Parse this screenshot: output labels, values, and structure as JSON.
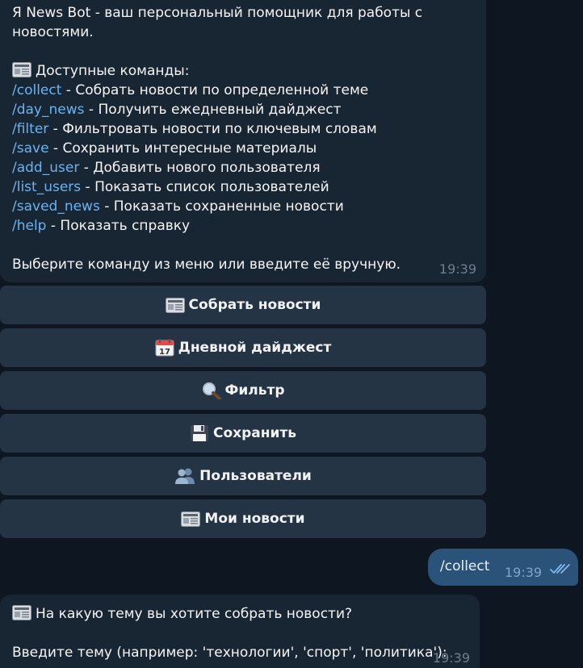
{
  "bot_message": {
    "intro_line1": "Я News Bot - ваш персональный помощник для работы с",
    "intro_line2": "новостями.",
    "commands_header": "Доступные команды:",
    "commands": [
      {
        "cmd": "/collect",
        "desc": " - Собрать новости по определенной теме"
      },
      {
        "cmd": "/day_news",
        "desc": " - Получить ежедневный дайджест"
      },
      {
        "cmd": "/filter",
        "desc": " - Фильтровать новости по ключевым словам"
      },
      {
        "cmd": "/save",
        "desc": " - Сохранить интересные материалы"
      },
      {
        "cmd": "/add_user",
        "desc": " - Добавить нового пользователя"
      },
      {
        "cmd": "/list_users",
        "desc": " - Показать список пользователей"
      },
      {
        "cmd": "/saved_news",
        "desc": " - Показать сохраненные новости"
      },
      {
        "cmd": "/help",
        "desc": " - Показать справку"
      }
    ],
    "footer": "Выберите команду из меню или введите её вручную.",
    "time": "19:39"
  },
  "keyboard": [
    {
      "icon": "newspaper-icon",
      "label": "Собрать новости"
    },
    {
      "icon": "calendar-icon",
      "label": "Дневной дайджест"
    },
    {
      "icon": "magnifier-icon",
      "label": "Фильтр"
    },
    {
      "icon": "floppy-icon",
      "label": "Сохранить"
    },
    {
      "icon": "users-icon",
      "label": "Пользователи"
    },
    {
      "icon": "newspaper-icon",
      "label": "Мои новости"
    }
  ],
  "outgoing": {
    "text": "/collect",
    "time": "19:39"
  },
  "bot_reply": {
    "line1": "На какую тему вы хотите собрать новости?",
    "line2": "Введите тему (например: 'технологии', 'спорт', 'политика'):",
    "time": "19:39"
  },
  "colors": {
    "background": "#0e1621",
    "incoming_bubble": "#182533",
    "outgoing_bubble": "#2b5278",
    "keyboard_button": "#243444",
    "link": "#6ab3f3"
  }
}
